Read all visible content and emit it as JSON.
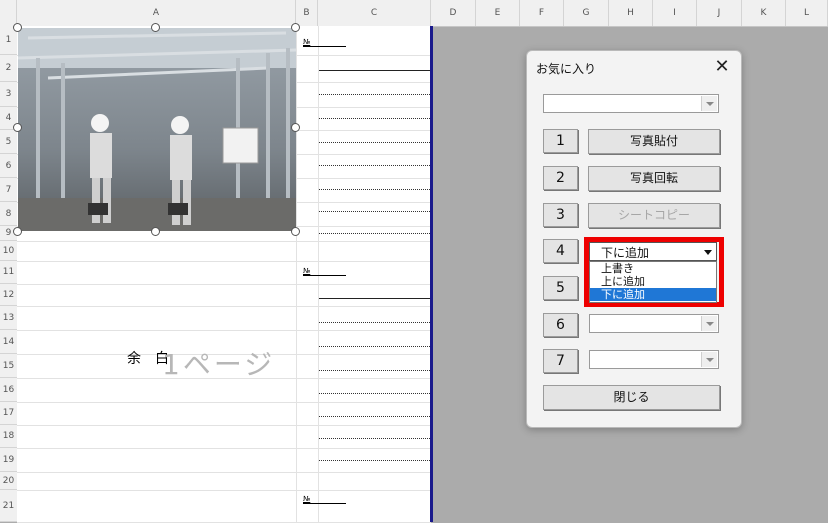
{
  "spreadsheet": {
    "columns": [
      "A",
      "B",
      "C",
      "D",
      "E",
      "F",
      "G",
      "H",
      "I",
      "J",
      "K",
      "L"
    ],
    "rows": [
      "1",
      "2",
      "3",
      "4",
      "5",
      "6",
      "7",
      "8",
      "9",
      "10",
      "11",
      "12",
      "13",
      "14",
      "15",
      "16",
      "17",
      "18",
      "19",
      "20",
      "21"
    ],
    "number_label": "№",
    "margin_text": "余　白",
    "page_watermark": "1ページ"
  },
  "dialog": {
    "title": "お気に入り",
    "close_icon": "close-icon",
    "buttons": [
      {
        "num": "1",
        "label": "写真貼付",
        "enabled": true
      },
      {
        "num": "2",
        "label": "写真回転",
        "enabled": true
      },
      {
        "num": "3",
        "label": "シートコピー",
        "enabled": false
      },
      {
        "num": "4"
      },
      {
        "num": "5"
      },
      {
        "num": "6"
      },
      {
        "num": "7"
      }
    ],
    "combo4": {
      "value": "下に追加",
      "options": [
        "上書き",
        "上に追加",
        "下に追加"
      ],
      "selected_index": 2
    },
    "close_button": "閉じる"
  },
  "colors": {
    "highlight": "#ee0000",
    "selection": "#1f77d6",
    "print_boundary": "#1a1a8c"
  }
}
